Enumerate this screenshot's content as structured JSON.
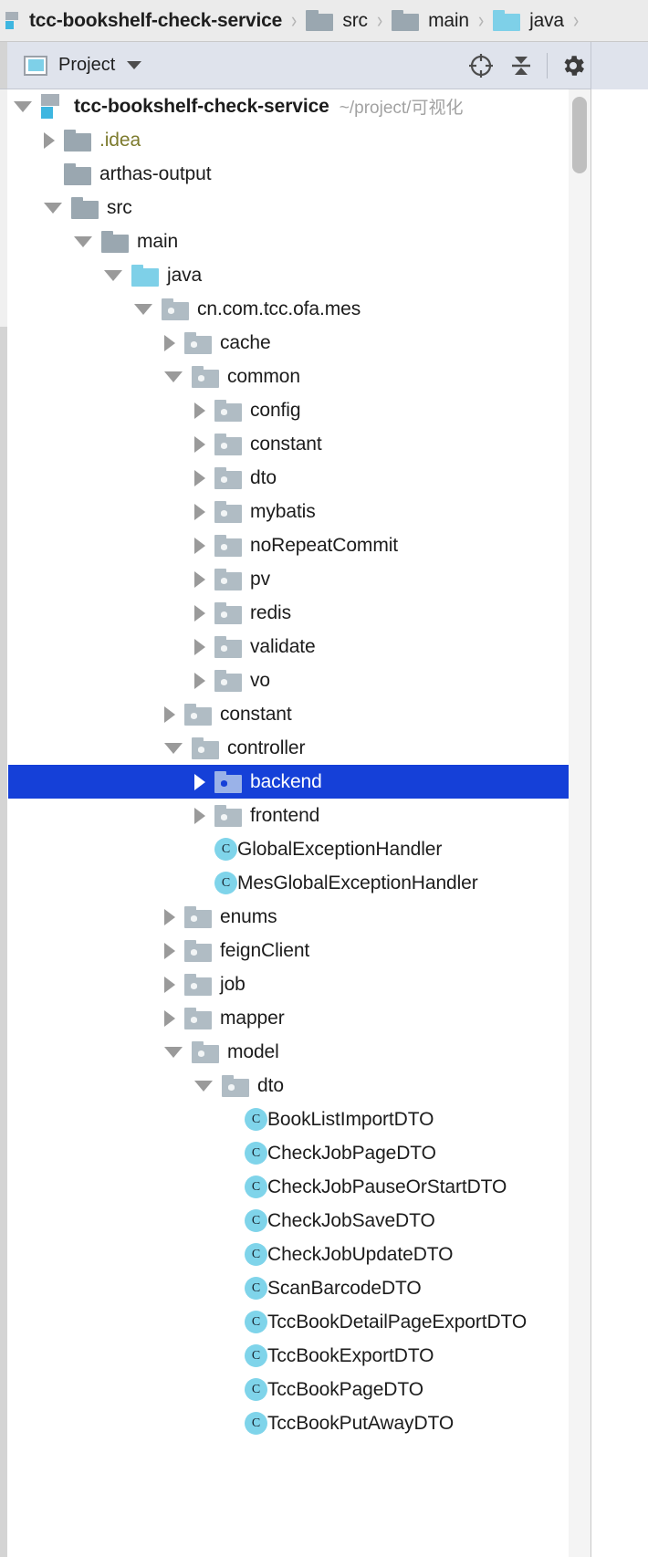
{
  "breadcrumb": {
    "items": [
      {
        "label": "tcc-bookshelf-check-service",
        "icon": "module-icon",
        "kind": "module"
      },
      {
        "label": "src",
        "icon": "folder-icon",
        "kind": "folder-grey"
      },
      {
        "label": "main",
        "icon": "folder-icon",
        "kind": "folder-grey"
      },
      {
        "label": "java",
        "icon": "source-root-folder-icon",
        "kind": "folder-blue"
      }
    ],
    "separator": "›"
  },
  "toolwindow": {
    "title": "Project",
    "view_icon": "project-view-icon",
    "dropdown_icon": "chevron-down-icon",
    "actions": [
      {
        "name": "select-opened-file-icon",
        "glyph": "target"
      },
      {
        "name": "collapse-all-icon",
        "glyph": "collapse"
      },
      {
        "name": "settings-gear-icon",
        "glyph": "gear"
      },
      {
        "name": "hide-toolwindow-icon",
        "glyph": "minus"
      }
    ]
  },
  "colors": {
    "selection_blue": "#1540d8",
    "source_root_blue": "#7ed0e8",
    "folder_grey": "#9aa7b0",
    "package_grey": "#b0bcc4",
    "class_icon_blue": "#7fd4ea",
    "breadcrumb_bg": "#ebebeb",
    "toolbar_bg": "#dfe3ec"
  },
  "scrollbar": {
    "orientation": "vertical",
    "thumb_position_percent": 0
  },
  "tree": {
    "rows": [
      {
        "label": "tcc-bookshelf-check-service",
        "indent": 0,
        "arrow": "open",
        "icon": "module-icon",
        "bold": true,
        "hint": "~/project/可视化"
      },
      {
        "label": ".idea",
        "indent": 1,
        "arrow": "closed",
        "icon": "folder-grey-icon",
        "olive": true
      },
      {
        "label": "arthas-output",
        "indent": 1,
        "arrow": "none",
        "icon": "folder-grey-icon"
      },
      {
        "label": "src",
        "indent": 1,
        "arrow": "open",
        "icon": "folder-grey-icon"
      },
      {
        "label": "main",
        "indent": 2,
        "arrow": "open",
        "icon": "folder-grey-icon"
      },
      {
        "label": "java",
        "indent": 3,
        "arrow": "open",
        "icon": "source-root-folder-icon"
      },
      {
        "label": "cn.com.tcc.ofa.mes",
        "indent": 4,
        "arrow": "open",
        "icon": "package-icon"
      },
      {
        "label": "cache",
        "indent": 5,
        "arrow": "closed",
        "icon": "package-icon"
      },
      {
        "label": "common",
        "indent": 5,
        "arrow": "open",
        "icon": "package-icon"
      },
      {
        "label": "config",
        "indent": 6,
        "arrow": "closed",
        "icon": "package-icon"
      },
      {
        "label": "constant",
        "indent": 6,
        "arrow": "closed",
        "icon": "package-icon"
      },
      {
        "label": "dto",
        "indent": 6,
        "arrow": "closed",
        "icon": "package-icon"
      },
      {
        "label": "mybatis",
        "indent": 6,
        "arrow": "closed",
        "icon": "package-icon"
      },
      {
        "label": "noRepeatCommit",
        "indent": 6,
        "arrow": "closed",
        "icon": "package-icon"
      },
      {
        "label": "pv",
        "indent": 6,
        "arrow": "closed",
        "icon": "package-icon"
      },
      {
        "label": "redis",
        "indent": 6,
        "arrow": "closed",
        "icon": "package-icon"
      },
      {
        "label": "validate",
        "indent": 6,
        "arrow": "closed",
        "icon": "package-icon"
      },
      {
        "label": "vo",
        "indent": 6,
        "arrow": "closed",
        "icon": "package-icon"
      },
      {
        "label": "constant",
        "indent": 5,
        "arrow": "closed",
        "icon": "package-icon"
      },
      {
        "label": "controller",
        "indent": 5,
        "arrow": "open",
        "icon": "package-icon"
      },
      {
        "label": "backend",
        "indent": 6,
        "arrow": "closed",
        "icon": "package-icon",
        "selected": true
      },
      {
        "label": "frontend",
        "indent": 6,
        "arrow": "closed",
        "icon": "package-icon"
      },
      {
        "label": "GlobalExceptionHandler",
        "indent": 6,
        "arrow": "none",
        "icon": "class-icon"
      },
      {
        "label": "MesGlobalExceptionHandler",
        "indent": 6,
        "arrow": "none",
        "icon": "class-icon"
      },
      {
        "label": "enums",
        "indent": 5,
        "arrow": "closed",
        "icon": "package-icon"
      },
      {
        "label": "feignClient",
        "indent": 5,
        "arrow": "closed",
        "icon": "package-icon"
      },
      {
        "label": "job",
        "indent": 5,
        "arrow": "closed",
        "icon": "package-icon"
      },
      {
        "label": "mapper",
        "indent": 5,
        "arrow": "closed",
        "icon": "package-icon"
      },
      {
        "label": "model",
        "indent": 5,
        "arrow": "open",
        "icon": "package-icon"
      },
      {
        "label": "dto",
        "indent": 6,
        "arrow": "open",
        "icon": "package-icon"
      },
      {
        "label": "BookListImportDTO",
        "indent": 7,
        "arrow": "none",
        "icon": "class-icon"
      },
      {
        "label": "CheckJobPageDTO",
        "indent": 7,
        "arrow": "none",
        "icon": "class-icon"
      },
      {
        "label": "CheckJobPauseOrStartDTO",
        "indent": 7,
        "arrow": "none",
        "icon": "class-icon"
      },
      {
        "label": "CheckJobSaveDTO",
        "indent": 7,
        "arrow": "none",
        "icon": "class-icon"
      },
      {
        "label": "CheckJobUpdateDTO",
        "indent": 7,
        "arrow": "none",
        "icon": "class-icon"
      },
      {
        "label": "ScanBarcodeDTO",
        "indent": 7,
        "arrow": "none",
        "icon": "class-icon"
      },
      {
        "label": "TccBookDetailPageExportDTO",
        "indent": 7,
        "arrow": "none",
        "icon": "class-icon"
      },
      {
        "label": "TccBookExportDTO",
        "indent": 7,
        "arrow": "none",
        "icon": "class-icon"
      },
      {
        "label": "TccBookPageDTO",
        "indent": 7,
        "arrow": "none",
        "icon": "class-icon"
      },
      {
        "label": "TccBookPutAwayDTO",
        "indent": 7,
        "arrow": "none",
        "icon": "class-icon"
      }
    ]
  }
}
